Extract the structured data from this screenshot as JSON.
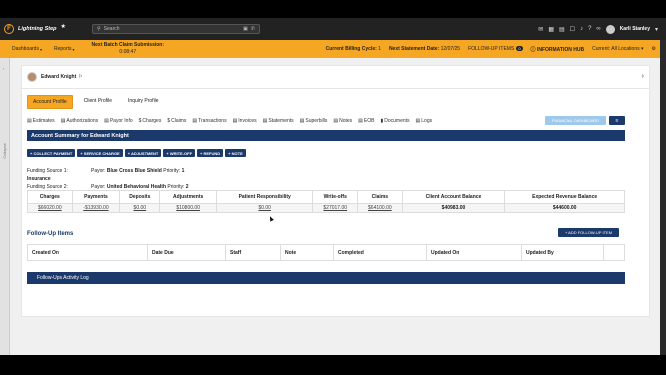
{
  "app": {
    "name": "Lightning Step",
    "logo_letter": "F"
  },
  "search": {
    "placeholder": "Search"
  },
  "user": {
    "name": "Karli Stanley"
  },
  "nav": {
    "dashboards": "Dashboards",
    "reports": "Reports",
    "batch_title": "Next Batch Claim Submission:",
    "batch_time": "0:08:47",
    "billing_cycle_label": "Current Billing Cycle:",
    "billing_cycle_value": "1",
    "statement_label": "Next Statement Date:",
    "statement_value": "12/07/25",
    "followup_label": "FOLLOW-UP ITEMS",
    "followup_count": "0",
    "info_hub": "INFORMATION HUB",
    "locations": "Current: All Locations"
  },
  "sidebar": {
    "label": "Collapse"
  },
  "patient": {
    "name": "Edward Knight"
  },
  "profile_tabs": [
    "Account Profile",
    "Client Profile",
    "Inquiry Profile"
  ],
  "subtabs": [
    "Estimates",
    "Authorizations",
    "Payor Info",
    "Charges",
    "Claims",
    "Transactions",
    "Invoices",
    "Statements",
    "Superbills",
    "Notes",
    "EOB",
    "Documents",
    "Logs"
  ],
  "buttons": {
    "financial_dashboard": "FINANCIAL DASHBOARD",
    "add_followup": "+ ADD FOLLOW-UP ITEM"
  },
  "summary_title": "Account Summary for Edward Knight",
  "actions": [
    "+ COLLECT PAYMENT",
    "+ SERVICE CHARGE",
    "+ ADJUSTMENT",
    "+ WRITE-OFF",
    "+ REFUND",
    "+ NOTE"
  ],
  "funding": [
    {
      "label": "Funding Source 1:",
      "type": "Insurance",
      "payor_label": "Payor:",
      "payor": "Blue Cross Blue Shield",
      "priority_label": "Priority:",
      "priority": "1"
    },
    {
      "label": "Funding Source 2:",
      "type": "Insurance",
      "payor_label": "Payor:",
      "payor": "United Behavioral Health",
      "priority_label": "Priority:",
      "priority": "2"
    }
  ],
  "summary_table": {
    "headers": [
      "Charges",
      "Payments",
      "Deposits",
      "Adjustments",
      "Patient Responsibility",
      "Write-offs",
      "Claims",
      "Client Account Balance",
      "Expected Revenue Balance"
    ],
    "values": [
      "$66020.00",
      "-$13930.00",
      "$0.00",
      "$10800.00",
      "$0.00",
      "$27017.00",
      "$64100.00",
      "$40983.00",
      "$44600.00"
    ]
  },
  "followup": {
    "title": "Follow-Up Items",
    "headers": [
      "Created On",
      "Date Due",
      "Staff",
      "Note",
      "Completed",
      "Updated On",
      "Updated By",
      ""
    ]
  },
  "log_bar": "Follow-Ups Activity Log"
}
